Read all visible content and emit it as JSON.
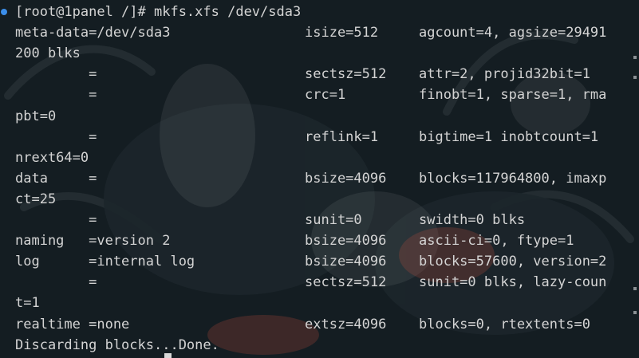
{
  "terminal": {
    "lines": [
      {
        "a": "[root@1panel /]# mkfs.xfs /dev/sda3",
        "b": "",
        "c": ""
      },
      {
        "a": "meta-data=/dev/sda3",
        "b": "isize=512",
        "c": "agcount=4, agsize=29491"
      },
      {
        "a": "200 blks",
        "b": "",
        "c": ""
      },
      {
        "a": "         =",
        "b": "sectsz=512",
        "c": "attr=2, projid32bit=1"
      },
      {
        "a": "         =",
        "b": "crc=1",
        "c": "finobt=1, sparse=1, rma"
      },
      {
        "a": "pbt=0",
        "b": "",
        "c": ""
      },
      {
        "a": "         =",
        "b": "reflink=1",
        "c": "bigtime=1 inobtcount=1"
      },
      {
        "a": "nrext64=0",
        "b": "",
        "c": ""
      },
      {
        "a": "data     =",
        "b": "bsize=4096",
        "c": "blocks=117964800, imaxp"
      },
      {
        "a": "ct=25",
        "b": "",
        "c": ""
      },
      {
        "a": "         =",
        "b": "sunit=0",
        "c": "swidth=0 blks"
      },
      {
        "a": "naming   =version 2",
        "b": "bsize=4096",
        "c": "ascii-ci=0, ftype=1"
      },
      {
        "a": "log      =internal log",
        "b": "bsize=4096",
        "c": "blocks=57600, version=2"
      },
      {
        "a": "         =",
        "b": "sectsz=512",
        "c": "sunit=0 blks, lazy-coun"
      },
      {
        "a": "t=1",
        "b": "",
        "c": ""
      },
      {
        "a": "realtime =none",
        "b": "extsz=4096",
        "c": "blocks=0, rtextents=0"
      },
      {
        "a": "Discarding blocks...Done.",
        "b": "",
        "c": ""
      }
    ]
  },
  "colors": {
    "background": "#141d22",
    "text": "#d4d4d4",
    "prompt_marker": "#3b8eea"
  }
}
